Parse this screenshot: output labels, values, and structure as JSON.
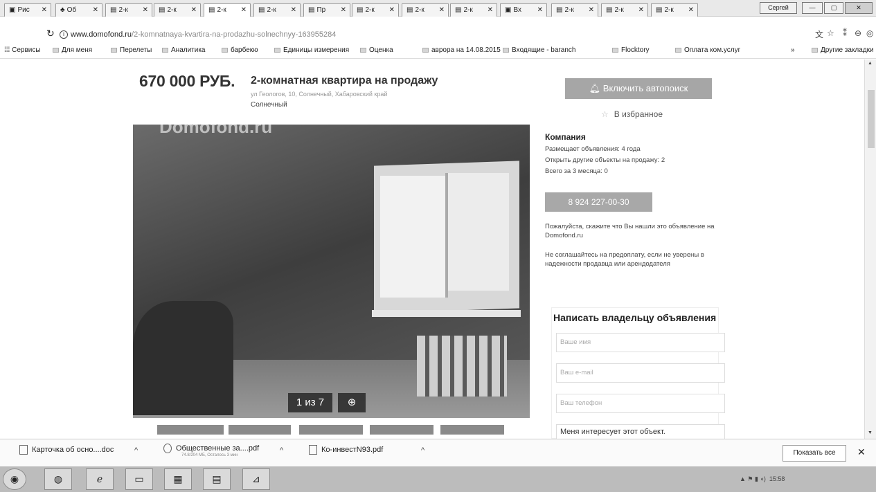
{
  "tabs": [
    {
      "label": "Рис",
      "icon": "▣"
    },
    {
      "label": "Об",
      "icon": "♣"
    },
    {
      "label": "2-к",
      "icon": "▤"
    },
    {
      "label": "2-к",
      "icon": "▤"
    },
    {
      "label": "2-к",
      "icon": "▤",
      "active": true
    },
    {
      "label": "2-к",
      "icon": "▤"
    },
    {
      "label": "Пр",
      "icon": "▤"
    },
    {
      "label": "2-к",
      "icon": "▤"
    },
    {
      "label": "2-к",
      "icon": "▤"
    },
    {
      "label": "2-к",
      "icon": "▤"
    },
    {
      "label": "Вх",
      "icon": "▣"
    },
    {
      "label": "2-к",
      "icon": "▤"
    },
    {
      "label": "2-к",
      "icon": "▤"
    },
    {
      "label": "2-к",
      "icon": "▤"
    }
  ],
  "window": {
    "profile_label": "Сергей",
    "minimize": "—",
    "maximize": "▢",
    "close": "✕"
  },
  "omnibox": {
    "domain": "www.domofond.ru",
    "path": "/2-komnatnaya-kvartira-na-prodazhu-solnechnyy-163955284"
  },
  "bookmarks": {
    "apps": "Сервисы",
    "items": [
      "Для меня",
      "Перелеты",
      "Аналитика",
      "барбекю",
      "Единицы измерения",
      "Оценка",
      "аврора на 14.08.2015",
      "Входящие - baranch",
      "Flocktory",
      "Оплата ком.услуг"
    ],
    "more": "»",
    "other": "Другие закладки"
  },
  "listing": {
    "price": "670 000 РУБ.",
    "title": "2-комнатная квартира на продажу",
    "address": "ул Геологов, 10, Солнечный, Хабаровский край",
    "city": "Солнечный",
    "autosearch": "Включить автопоиск",
    "favorites": "В избранное",
    "photo_watermark": "Domofond.ru",
    "photo_counter": "1 из 7",
    "zoom_icon": "⊕"
  },
  "seller": {
    "title": "Компания",
    "lines": [
      "Размещает объявления: 4 года",
      "Открыть другие объекты на продажу: 2",
      "Всего за 3 месяца: 0"
    ],
    "phone": "8 924 227-00-30",
    "note1": "Пожалуйста, скажите что Вы нашли это объявление на Domofond.ru",
    "note2": "Не соглашайтесь на предоплату, если не уверены в надежности продавца или арендодателя"
  },
  "contact": {
    "title": "Написать владельцу объявления",
    "name_placeholder": "Ваше имя",
    "email_placeholder": "Ваш e-mail",
    "phone_placeholder": "Ваш телефон",
    "message": "Меня интересует этот объект."
  },
  "downloads": [
    {
      "name": "Карточка об осно....doc"
    },
    {
      "name": "Общественные за....pdf",
      "sub": "74.8/204 МБ, Осталось 3 мин"
    },
    {
      "name": "Ко-инвестN93.pdf"
    }
  ],
  "downloads_ui": {
    "show_all": "Показать все",
    "close": "✕",
    "caret": "^"
  },
  "taskbar": {
    "tray_time": "15:58"
  }
}
